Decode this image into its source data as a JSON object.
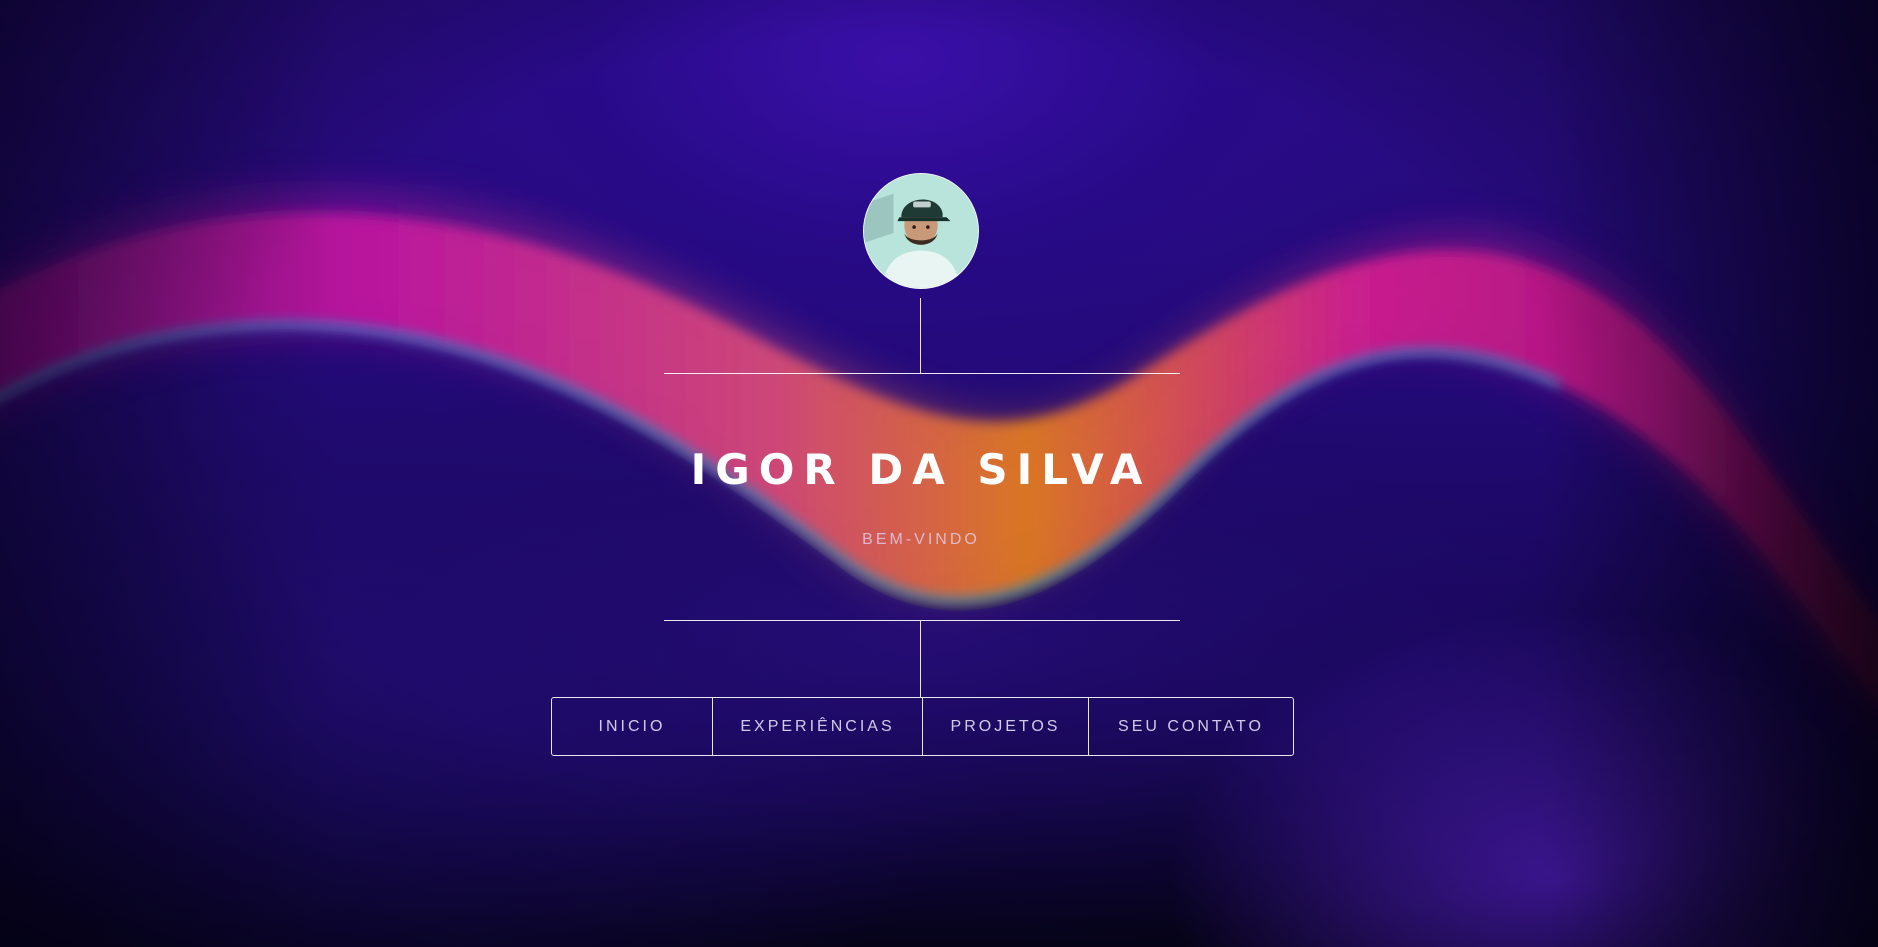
{
  "hero": {
    "name": "IGOR DA SILVA",
    "tagline": "BEM-VINDO",
    "avatar_icon": "profile-photo"
  },
  "nav": {
    "items": [
      {
        "label": "INICIO"
      },
      {
        "label": "EXPERIÊNCIAS"
      },
      {
        "label": "PROJETOS"
      },
      {
        "label": "SEU CONTATO"
      }
    ]
  },
  "colors": {
    "background_deep": "#150650",
    "background_mid": "#2a0c86",
    "wave_magenta": "#c0189f",
    "wave_orange": "#e07a22",
    "wave_cyan": "#1fc8ee",
    "line_color": "#ffffff"
  }
}
